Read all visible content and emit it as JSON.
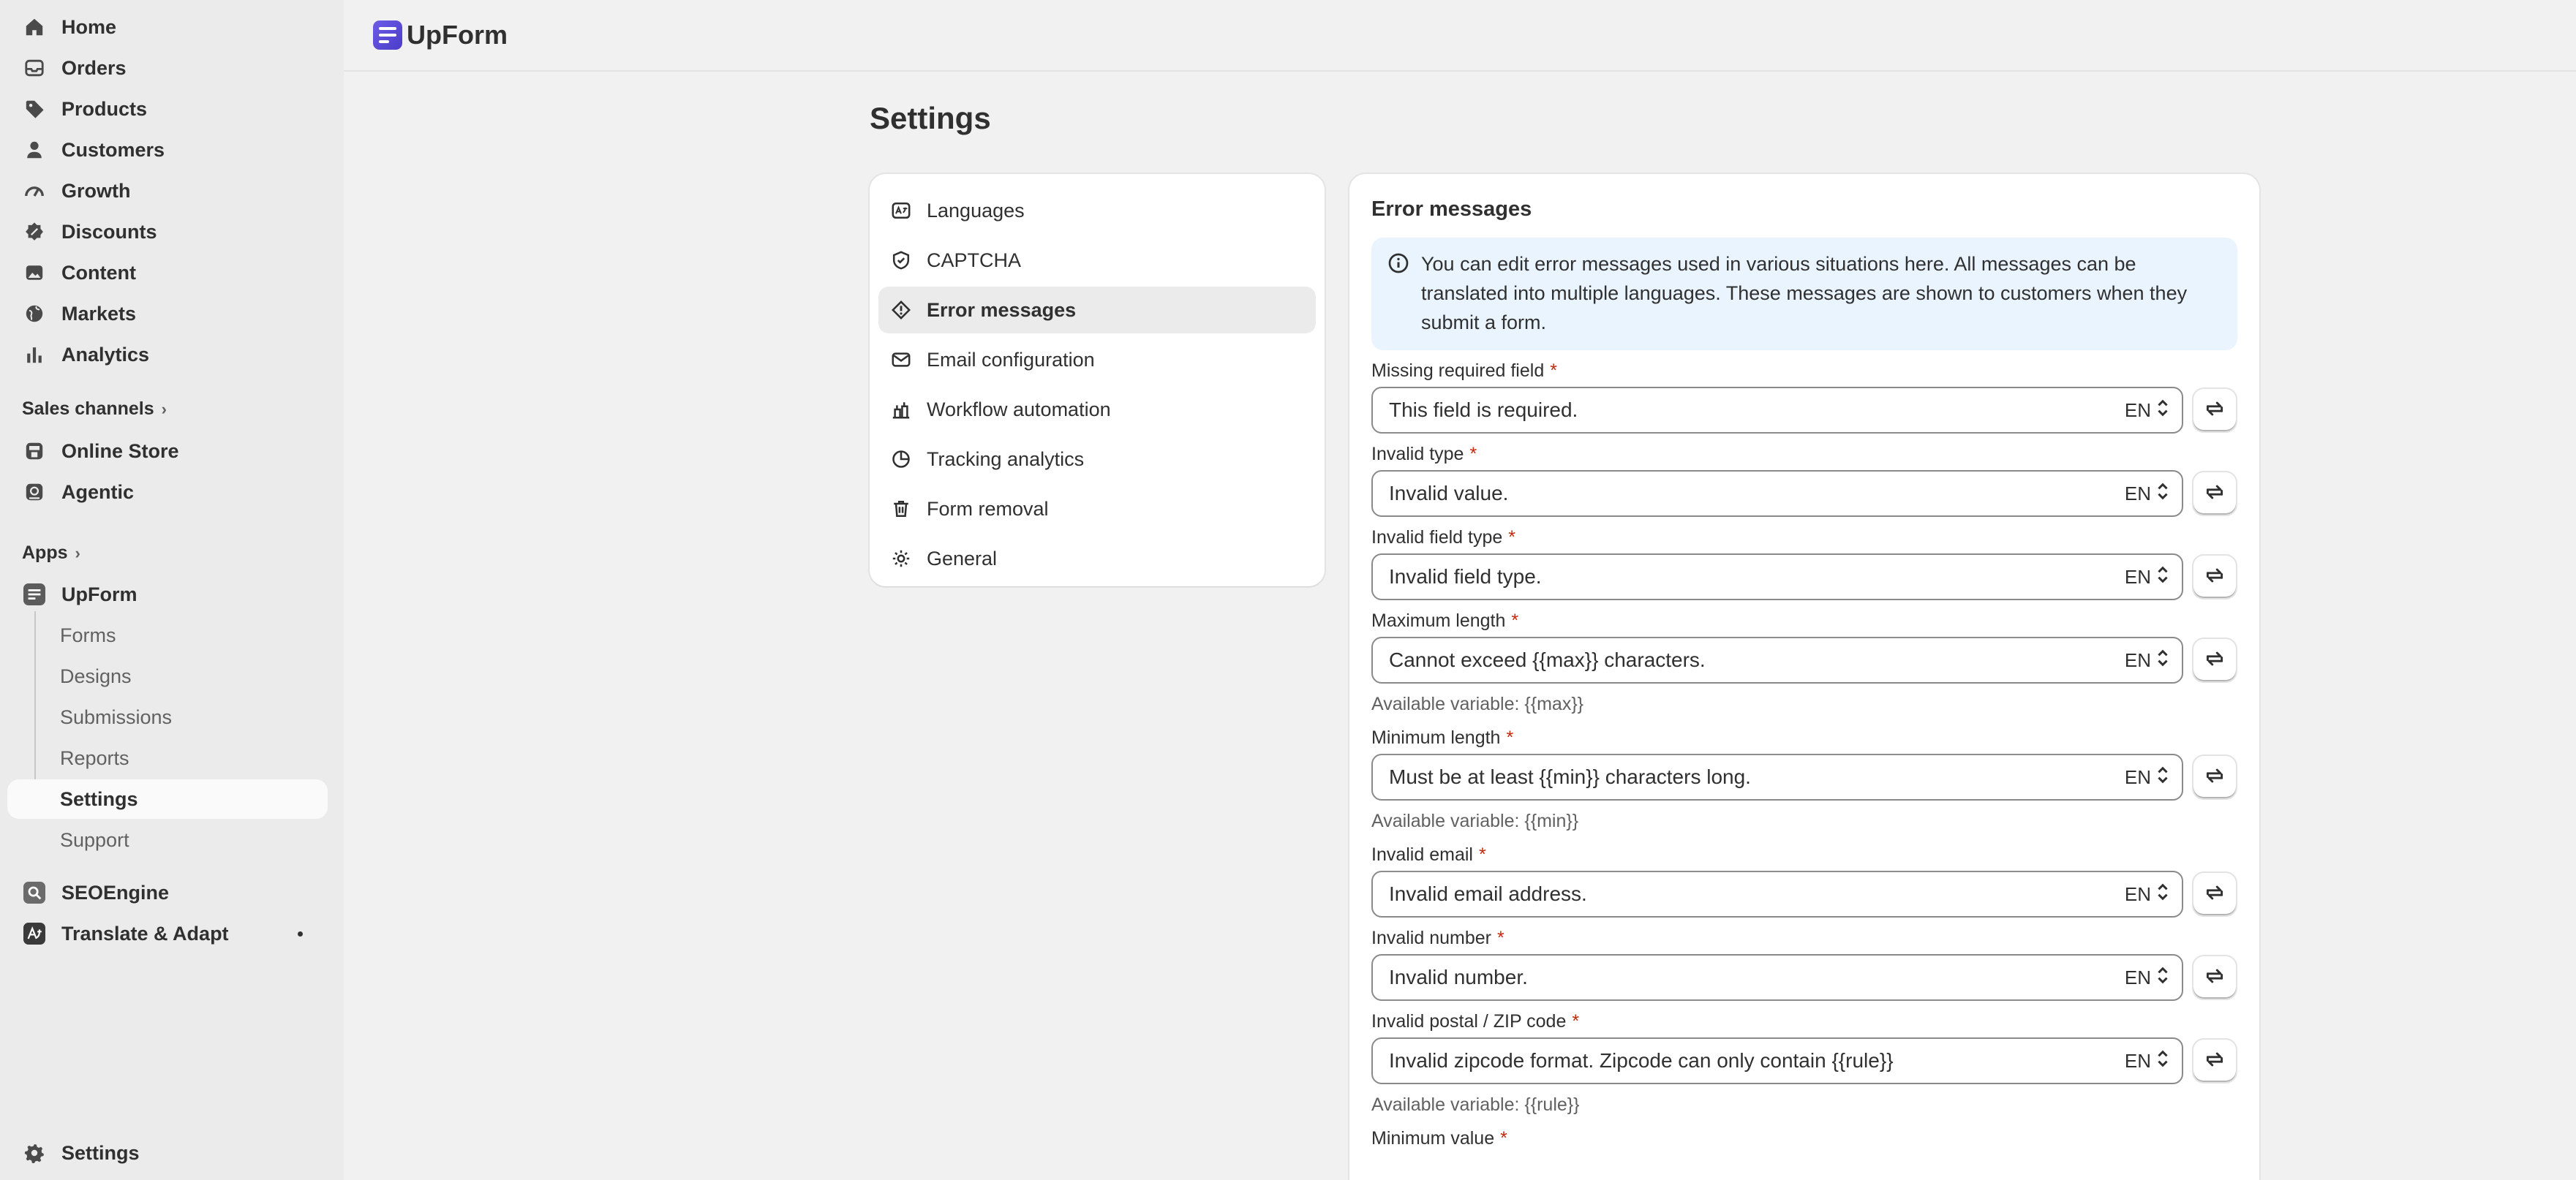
{
  "sidebar": {
    "main": [
      {
        "label": "Home",
        "icon": "home-icon"
      },
      {
        "label": "Orders",
        "icon": "inbox-icon"
      },
      {
        "label": "Products",
        "icon": "tag-icon"
      },
      {
        "label": "Customers",
        "icon": "person-icon"
      },
      {
        "label": "Growth",
        "icon": "gauge-icon"
      },
      {
        "label": "Discounts",
        "icon": "discount-icon"
      },
      {
        "label": "Content",
        "icon": "image-icon"
      },
      {
        "label": "Markets",
        "icon": "globe-icon"
      },
      {
        "label": "Analytics",
        "icon": "bar-chart-icon"
      }
    ],
    "sales_channels_label": "Sales channels",
    "sales_channels": [
      {
        "label": "Online Store",
        "icon": "store-icon"
      },
      {
        "label": "Agentic",
        "icon": "agentic-icon"
      }
    ],
    "apps_label": "Apps",
    "upform_label": "UpForm",
    "upform_sub": [
      "Forms",
      "Designs",
      "Submissions",
      "Reports",
      "Settings",
      "Support"
    ],
    "seoengine_label": "SEOEngine",
    "translate_label": "Translate & Adapt",
    "settings_label": "Settings"
  },
  "topbar": {
    "brand": "UpForm"
  },
  "page": {
    "title": "Settings"
  },
  "settings_nav": [
    {
      "label": "Languages",
      "icon": "language-icon"
    },
    {
      "label": "CAPTCHA",
      "icon": "shield-check-icon"
    },
    {
      "label": "Error messages",
      "icon": "alert-diamond-icon"
    },
    {
      "label": "Email configuration",
      "icon": "envelope-icon"
    },
    {
      "label": "Workflow automation",
      "icon": "workflow-icon"
    },
    {
      "label": "Tracking analytics",
      "icon": "chart-pie-icon"
    },
    {
      "label": "Form removal",
      "icon": "trash-icon"
    },
    {
      "label": "General",
      "icon": "gear-icon"
    }
  ],
  "error_messages": {
    "title": "Error messages",
    "banner": "You can edit error messages used in various situations here. All messages can be translated into multiple languages. These messages are shown to customers when they submit a form.",
    "required_mark": "*",
    "fields": [
      {
        "label": "Missing required field",
        "value": "This field is required.",
        "lang": "EN",
        "help": ""
      },
      {
        "label": "Invalid type",
        "value": "Invalid value.",
        "lang": "EN",
        "help": ""
      },
      {
        "label": "Invalid field type",
        "value": "Invalid field type.",
        "lang": "EN",
        "help": ""
      },
      {
        "label": "Maximum length",
        "value": "Cannot exceed {{max}} characters.",
        "lang": "EN",
        "help": "Available variable: {{max}}"
      },
      {
        "label": "Minimum length",
        "value": "Must be at least {{min}} characters long.",
        "lang": "EN",
        "help": "Available variable: {{min}}"
      },
      {
        "label": "Invalid email",
        "value": "Invalid email address.",
        "lang": "EN",
        "help": ""
      },
      {
        "label": "Invalid number",
        "value": "Invalid number.",
        "lang": "EN",
        "help": ""
      },
      {
        "label": "Invalid postal / ZIP code",
        "value": "Invalid zipcode format. Zipcode can only contain {{rule}}",
        "lang": "EN",
        "help": "Available variable: {{rule}}"
      },
      {
        "label": "Minimum value",
        "value": "",
        "lang": "",
        "help": ""
      }
    ]
  }
}
